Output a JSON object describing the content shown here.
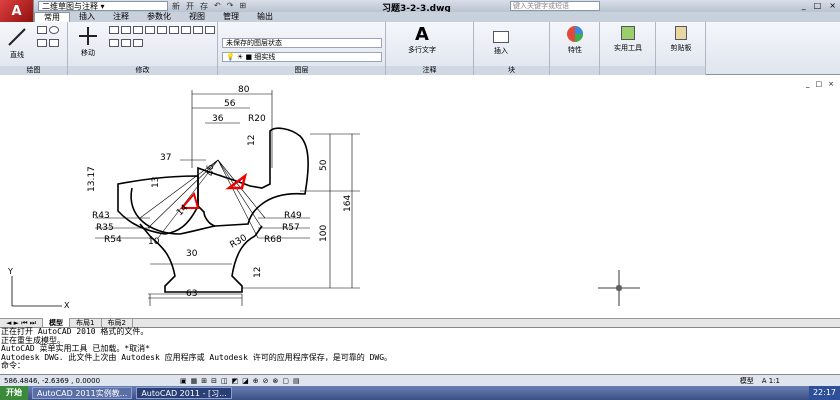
{
  "titlebar": {
    "workspace": "二维草图与注释",
    "document_title": "习题3-2-3.dwg",
    "search_placeholder": "键入关键字或短语",
    "qat": [
      "新",
      "开",
      "存",
      "↶",
      "↷",
      "⊞"
    ],
    "win": [
      "_",
      "□",
      "×"
    ]
  },
  "menubar": [
    "常用",
    "插入",
    "注释",
    "参数化",
    "视图",
    "管理",
    "输出"
  ],
  "ribbon": {
    "panels": [
      {
        "name": "draw",
        "label": "绘图",
        "tool": "直线"
      },
      {
        "name": "modify",
        "label": "修改",
        "tool": "移动"
      },
      {
        "name": "layers",
        "label": "图层",
        "state": "未保存的图层状态",
        "layer": "细实线"
      },
      {
        "name": "annotation",
        "label": "注释",
        "tool": "多行文字"
      },
      {
        "name": "block",
        "label": "块",
        "tool": "插入"
      },
      {
        "name": "props",
        "label": "",
        "tool": "特性"
      },
      {
        "name": "util",
        "label": "",
        "tool": "实用工具"
      },
      {
        "name": "clip",
        "label": "",
        "tool": "剪贴板"
      }
    ]
  },
  "dims": [
    "80",
    "56",
    "36",
    "R20",
    "12",
    "46",
    "50",
    "164",
    "37",
    "13.17",
    "13",
    "R43",
    "R35",
    "R54",
    "10",
    "R49",
    "R57",
    "R68",
    "R30",
    "100",
    "30",
    "12",
    "63",
    "14"
  ],
  "tabs": [
    "模型",
    "布局1",
    "布局2"
  ],
  "cmdlines": [
    "正在打开 AutoCAD 2010 格式的文件。",
    "正在重生成模型。",
    "AutoCAD 菜单实用工具 已加载。*取消*",
    "Autodesk DWG.    此文件上次由 Autodesk 应用程序或 Autodesk 许可的应用程序保存，是可靠的 DWG。",
    "命令："
  ],
  "status": {
    "coords": "586.4846, -2.6369 , 0.0000",
    "model": "模型",
    "scale": "A 1:1"
  },
  "taskbar": {
    "start": "开始",
    "tasks": [
      "AutoCAD 2011实例教...",
      "AutoCAD 2011 - [习..."
    ],
    "clock": "22:17"
  }
}
